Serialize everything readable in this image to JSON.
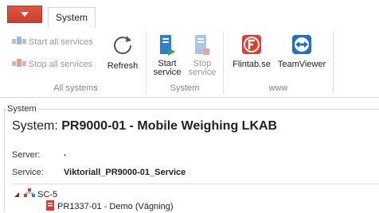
{
  "tabs": [
    {
      "label": "System"
    }
  ],
  "ribbon": {
    "all_systems": {
      "start_all": "Start all services",
      "stop_all": "Stop all services",
      "refresh": "Refresh",
      "label": "All systems"
    },
    "system": {
      "start_service_line1": "Start",
      "start_service_line2": "service",
      "stop_service_line1": "Stop",
      "stop_service_line2": "service",
      "label": "System"
    },
    "www": {
      "flintab": "Flintab.se",
      "teamviewer": "TeamViewer",
      "label": "www"
    }
  },
  "panel": {
    "title": "System",
    "heading_prefix": "System:",
    "heading_value": "PR9000-01 - Mobile Weighing LKAB",
    "server_label": "Server:",
    "server_value": ".",
    "service_label": "Service:",
    "service_value": "Viktoriall_PR9000-01_Service"
  },
  "tree": {
    "root": "SC-5",
    "child": "PR1337-01 - Demo (Vägning)"
  },
  "colors": {
    "accent_red": "#d9402d",
    "service_blue": "#2e7fd1",
    "teamviewer_blue": "#1e6fc8",
    "flintab_red": "#e23b2b"
  }
}
